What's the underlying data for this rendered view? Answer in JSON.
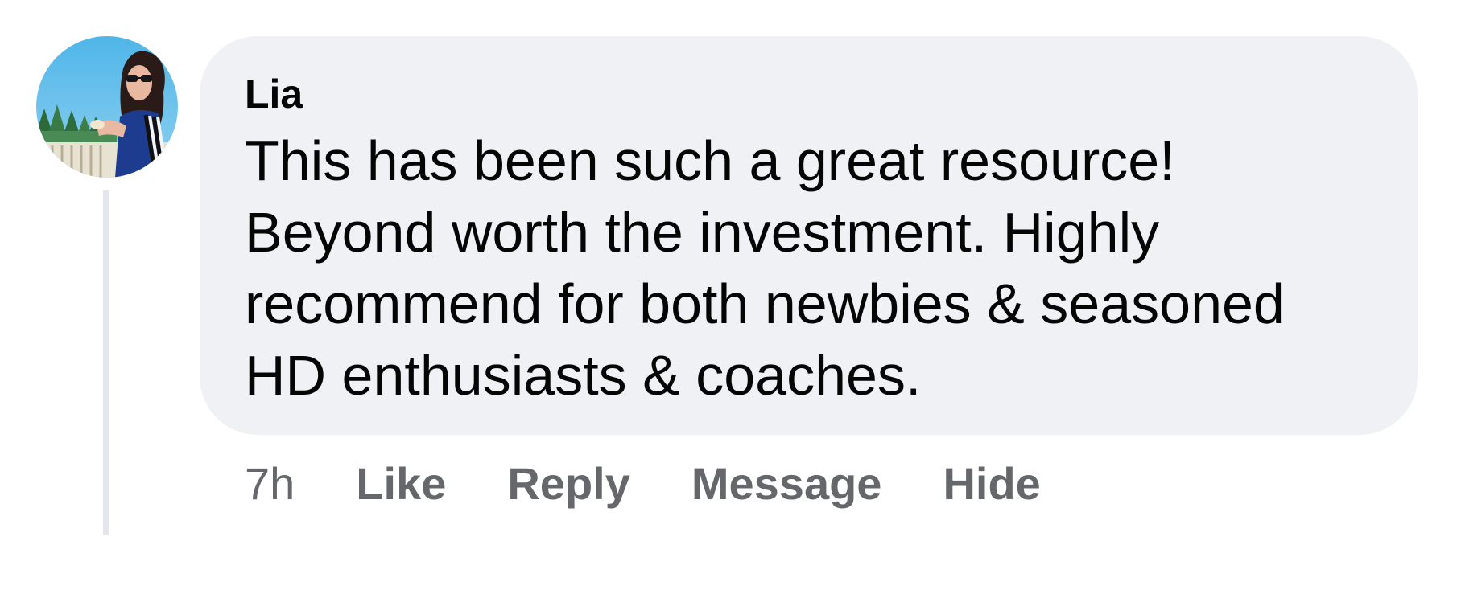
{
  "comment": {
    "author": "Lia",
    "text_lines": [
      "This has been such a great resource!",
      "Beyond worth the investment. Highly",
      "recommend for both newbies & seasoned",
      "HD enthusiasts & coaches."
    ],
    "timestamp": "7h",
    "actions": {
      "like": "Like",
      "reply": "Reply",
      "message": "Message",
      "hide": "Hide"
    }
  },
  "colors": {
    "bubble_bg": "#f0f1f5",
    "text": "#050505",
    "secondary_text": "#65676b",
    "thread_line": "#e4e6eb"
  },
  "icons": {
    "avatar": "profile-photo"
  }
}
